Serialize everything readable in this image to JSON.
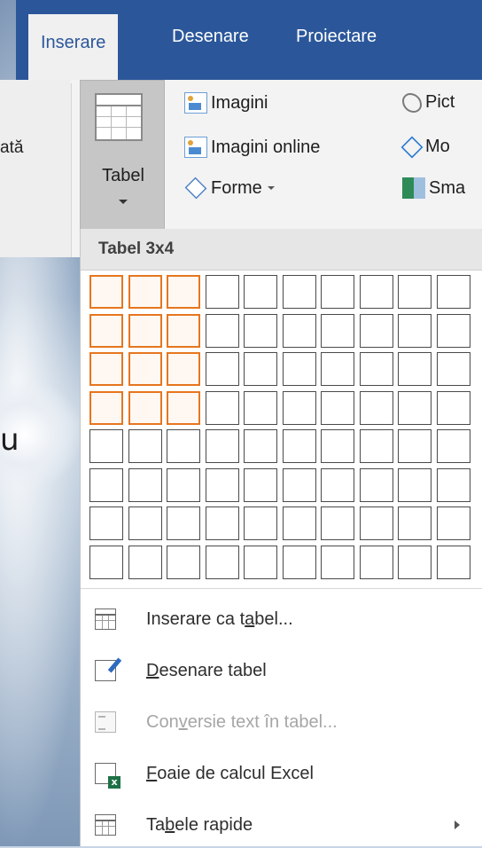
{
  "tabs": [
    "Inserare",
    "Desenare",
    "Proiectare"
  ],
  "active_tab": "Inserare",
  "left_partial_label": "ată",
  "background_letter": "u",
  "ribbon": {
    "tabel_label": "Tabel",
    "col1": [
      "Imagini",
      "Imagini online",
      "Forme"
    ],
    "col2": [
      "Pict",
      "Mo",
      "Sma"
    ]
  },
  "dropdown": {
    "header": "Tabel 3x4",
    "grid": {
      "columns": 10,
      "rows": 8,
      "selected_columns": 3,
      "selected_rows": 4
    },
    "items": [
      {
        "before": "Inserare ca t",
        "mnemonic": "a",
        "after": "bel...",
        "disabled": false,
        "icon": "insert-table-icon"
      },
      {
        "before": "",
        "mnemonic": "D",
        "after": "esenare tabel",
        "disabled": false,
        "icon": "draw-table-icon"
      },
      {
        "before": "Con",
        "mnemonic": "v",
        "after": "ersie text în tabel...",
        "disabled": true,
        "icon": "convert-text-icon"
      },
      {
        "before": "",
        "mnemonic": "F",
        "after": "oaie de calcul Excel",
        "disabled": false,
        "icon": "excel-sheet-icon"
      },
      {
        "before": "Ta",
        "mnemonic": "b",
        "after": "ele rapide",
        "disabled": false,
        "icon": "quick-tables-icon"
      }
    ]
  },
  "colors": {
    "ribbon_tab_bar": "#2b579a",
    "selected_cell_border": "#e6761f",
    "disabled_text": "#a6a6a6"
  }
}
